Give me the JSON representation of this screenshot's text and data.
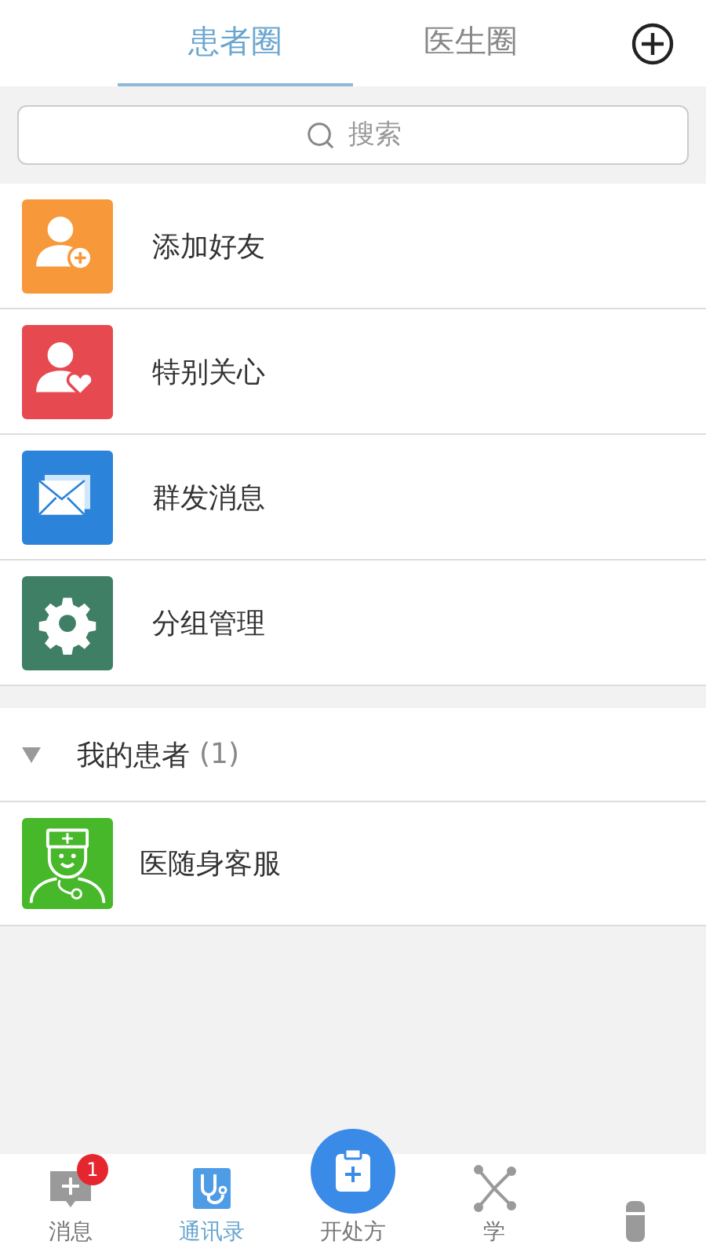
{
  "tabs": [
    {
      "label": "患者圈",
      "selected": true
    },
    {
      "label": "医生圈",
      "selected": false
    }
  ],
  "search": {
    "placeholder": "搜索"
  },
  "menu": [
    {
      "kind": "add-person",
      "label": "添加好友",
      "color": "#f7983a"
    },
    {
      "kind": "heart-person",
      "label": "特别关心",
      "color": "#e64a50"
    },
    {
      "kind": "envelope",
      "label": "群发消息",
      "color": "#2b84d9"
    },
    {
      "kind": "gear",
      "label": "分组管理",
      "color": "#3f7f66"
    }
  ],
  "group": {
    "title": "我的患者",
    "count": "(1)",
    "expanded": true,
    "children": [
      {
        "name": "医随身客服"
      }
    ]
  },
  "bottom_nav": [
    {
      "kind": "chat",
      "label": "消息",
      "badge": "1",
      "selected": false
    },
    {
      "kind": "stethoscope",
      "label": "通讯录",
      "selected": true
    },
    {
      "kind": "prescription",
      "label": "开处方",
      "selected": false
    },
    {
      "kind": "network",
      "label": "学",
      "selected": false
    },
    {
      "kind": "kit",
      "selected": false
    }
  ]
}
